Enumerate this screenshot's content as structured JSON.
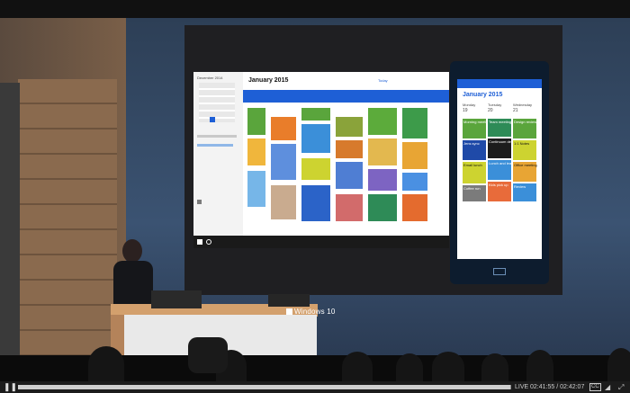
{
  "brand": "Windows 10",
  "player": {
    "live_label": "LIVE",
    "time_text": "02:41:55 / 02:42:07",
    "cc_label": "CC",
    "play_icon": "play-icon",
    "volume_icon": "volume-icon",
    "fullscreen_icon": "fullscreen-icon"
  },
  "desktop_calendar": {
    "mini_month": "December 2014",
    "main_title": "January 2015",
    "tab_today": "Today"
  },
  "phone_calendar": {
    "title": "January 2015",
    "days": [
      "Monday",
      "Tuesday",
      "Wednesday"
    ],
    "dates": [
      "19",
      "20",
      "21"
    ],
    "events": [
      "Morning meeting",
      "Jens sync",
      "Email lunch",
      "Coffee run",
      "Team meeting",
      "Continuum demo",
      "Lunch and learn",
      "Kids pick up",
      "Design review",
      "1:1 Notes",
      "Office meeting",
      "Review"
    ]
  }
}
